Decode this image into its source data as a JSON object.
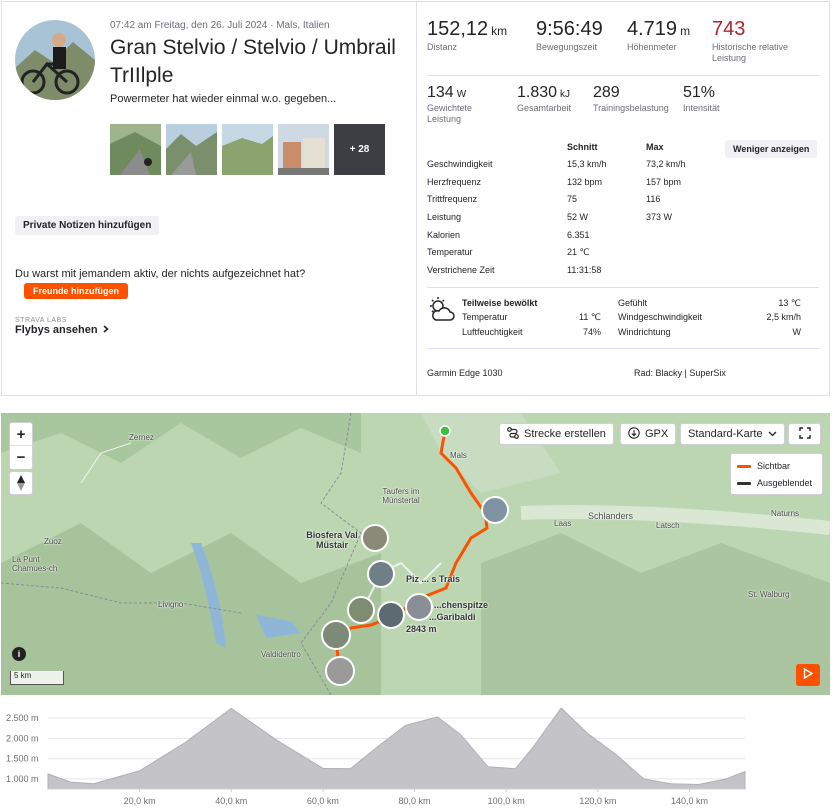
{
  "activity": {
    "meta": "07:42 am Freitag, den 26. Juli 2024 · Mals, Italien",
    "title": "Gran Stelvio / Stelvio / Umbrail TrIIlple",
    "description": "Powermeter hat wieder einmal w.o. gegeben...",
    "more_photos": "+ 28",
    "private_notes_button": "Private Notizen hinzufügen",
    "question": "Du warst mit jemandem aktiv, der nichts aufgezeichnet hat?",
    "add_friends_button": "Freunde hinzufügen",
    "labs_label": "STRAVA LABS",
    "flybys_link": "Flybys ansehen"
  },
  "primary_stats": [
    {
      "value": "152,12",
      "unit": "km",
      "label": "Distanz"
    },
    {
      "value": "9:56:49",
      "unit": "",
      "label": "Bewegungszeit"
    },
    {
      "value": "4.719",
      "unit": "m",
      "label": "Höhenmeter"
    },
    {
      "value": "743",
      "unit": "",
      "label": "Historische relative Leistung"
    }
  ],
  "secondary_stats": [
    {
      "value": "134",
      "unit": "W",
      "label": "Gewichtete Leistung"
    },
    {
      "value": "1.830",
      "unit": "kJ",
      "label": "Gesamtarbeit"
    },
    {
      "value": "289",
      "unit": "",
      "label": "Trainingsbelastung"
    },
    {
      "value": "51%",
      "unit": "",
      "label": "Intensität"
    }
  ],
  "details_table": {
    "col_avg": "Schnitt",
    "col_max": "Max",
    "show_less_button": "Weniger anzeigen",
    "rows": [
      {
        "label": "Geschwindigkeit",
        "avg": "15,3 km/h",
        "max": "73,2 km/h"
      },
      {
        "label": "Herzfrequenz",
        "avg": "132 bpm",
        "max": "157 bpm"
      },
      {
        "label": "Trittfrequenz",
        "avg": "75",
        "max": "116"
      },
      {
        "label": "Leistung",
        "avg": "52 W",
        "max": "373 W"
      },
      {
        "label": "Kalorien",
        "avg": "6.351",
        "max": ""
      },
      {
        "label": "Temperatur",
        "avg": "21 ℃",
        "max": ""
      },
      {
        "label": "Verstrichene Zeit",
        "avg": "11:31:58",
        "max": ""
      }
    ]
  },
  "weather": {
    "condition": "Teilweise bewölkt",
    "temperature_label": "Temperatur",
    "temperature": "11 ℃",
    "humidity_label": "Luftfeuchtigkeit",
    "humidity": "74%",
    "feels_like_label": "Gefühlt",
    "feels_like": "13 ℃",
    "wind_speed_label": "Windgeschwindigkeit",
    "wind_speed": "2,5 km/h",
    "wind_dir_label": "Windrichtung",
    "wind_dir": "W"
  },
  "device": "Garmin Edge 1030",
  "bike": "Rad: Blacky | SuperSix",
  "map": {
    "zoom_in": "+",
    "zoom_out": "−",
    "create_route_button": "Strecke erstellen",
    "gpx_button": "GPX",
    "map_type_select": "Standard-Karte",
    "legend_visible": "Sichtbar",
    "legend_hidden": "Ausgeblendet",
    "scale_label": "5 km",
    "info": "i",
    "labels": {
      "zernez": "Zernez",
      "mals": "Mals",
      "taufers": "Taufers im Münstertal",
      "schlanders": "Schlanders",
      "laas": "Laas",
      "latsch": "Latsch",
      "zuoz": "Zuoz",
      "biosfera": "Biosfera Val Müstair",
      "lapunt": "La Punt Chamues-ch",
      "livigno": "Livigno",
      "pizzas": "Piz ... s Trais",
      "vertainspitze": "...chenspitze",
      "garibaldi": "...Garibaldi",
      "elev2843": "2843 m",
      "valdidentro": "Valdidentro",
      "stwalburg": "St. Walburg",
      "natums": "Naturns"
    },
    "colors": {
      "visible": "#fc5200",
      "hidden": "#333333"
    }
  },
  "elevation_chart": {
    "type": "area",
    "y_ticks": [
      "2.500 m",
      "2.000 m",
      "1.500 m",
      "1.000 m"
    ],
    "x_ticks": [
      "20,0 km",
      "40,0 km",
      "60,0 km",
      "80,0 km",
      "100,0 km",
      "120,0 km",
      "140,0 km"
    ],
    "ylim": [
      750,
      2750
    ],
    "xlim": [
      0,
      152.12
    ],
    "x": [
      0,
      5,
      10,
      20,
      30,
      40,
      50,
      60,
      66,
      72,
      78,
      85,
      90,
      96,
      102,
      106,
      112,
      118,
      124,
      130,
      136,
      142,
      148,
      152.12
    ],
    "y": [
      1120,
      920,
      880,
      1200,
      1900,
      2740,
      1950,
      1260,
      1250,
      1800,
      2320,
      2530,
      2100,
      1300,
      1250,
      1800,
      2750,
      2100,
      1600,
      1000,
      880,
      860,
      1000,
      1180
    ]
  }
}
